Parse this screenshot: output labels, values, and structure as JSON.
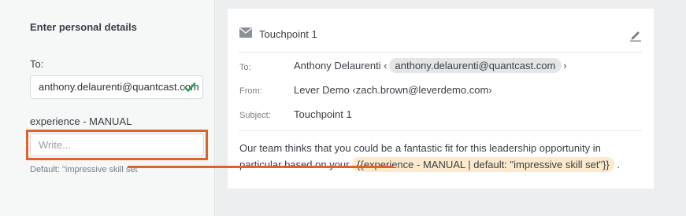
{
  "left_panel": {
    "title": "Enter personal details",
    "to_label": "To:",
    "to_value": "anthony.delaurenti@quantcast.com",
    "experience_label": "experience - MANUAL",
    "experience_placeholder": "Write...",
    "experience_default": "Default: \"impressive skill set\""
  },
  "email_card": {
    "title": "Touchpoint 1",
    "to_label": "To:",
    "to_name": "Anthony Delaurenti",
    "to_email": "anthony.delaurenti@quantcast.com",
    "from_label": "From:",
    "from_value": "Lever Demo ‹zach.brown@leverdemo.com›",
    "subject_label": "Subject:",
    "subject_value": "Touchpoint 1",
    "body_prefix": "Our team thinks that you could be a fantastic fit for this leadership opportunity in particular based on your",
    "body_token": "{{experience - MANUAL | default: \"impressive skill set\"}}",
    "body_suffix": "."
  },
  "colors": {
    "highlight": "#e0622b",
    "token_bg": "#fde9cc",
    "check": "#2fa05a"
  }
}
